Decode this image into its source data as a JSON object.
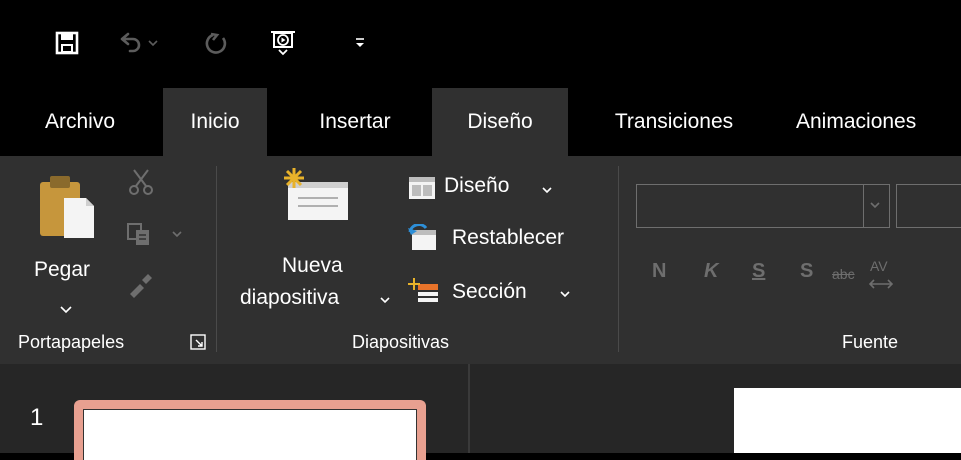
{
  "qat": {
    "icons": [
      "save-icon",
      "undo-icon",
      "undo-dropdown-icon",
      "redo-icon",
      "start-presentation-icon",
      "customize-qat-icon"
    ]
  },
  "tabs": [
    {
      "label": "Archivo"
    },
    {
      "label": "Inicio"
    },
    {
      "label": "Insertar"
    },
    {
      "label": "Diseño"
    },
    {
      "label": "Transiciones"
    },
    {
      "label": "Animaciones"
    }
  ],
  "ribbon": {
    "clipboard": {
      "paste_label": "Pegar",
      "group_label": "Portapapeles"
    },
    "slides": {
      "new_slide_line1": "Nueva",
      "new_slide_line2": "diapositiva",
      "layout_label": "Diseño",
      "reset_label": "Restablecer",
      "section_label": "Sección",
      "group_label": "Diapositivas"
    },
    "font": {
      "bold": "N",
      "italic": "K",
      "underline": "S",
      "strike": "S",
      "strikethrough_abc": "abc",
      "spacing": "AV",
      "group_label": "Fuente"
    }
  },
  "thumbnails": {
    "first_number": "1"
  },
  "colors": {
    "background": "#000000",
    "ribbon": "#303030",
    "thumbnail_border": "#e8a090",
    "active_tab": "#303030"
  }
}
